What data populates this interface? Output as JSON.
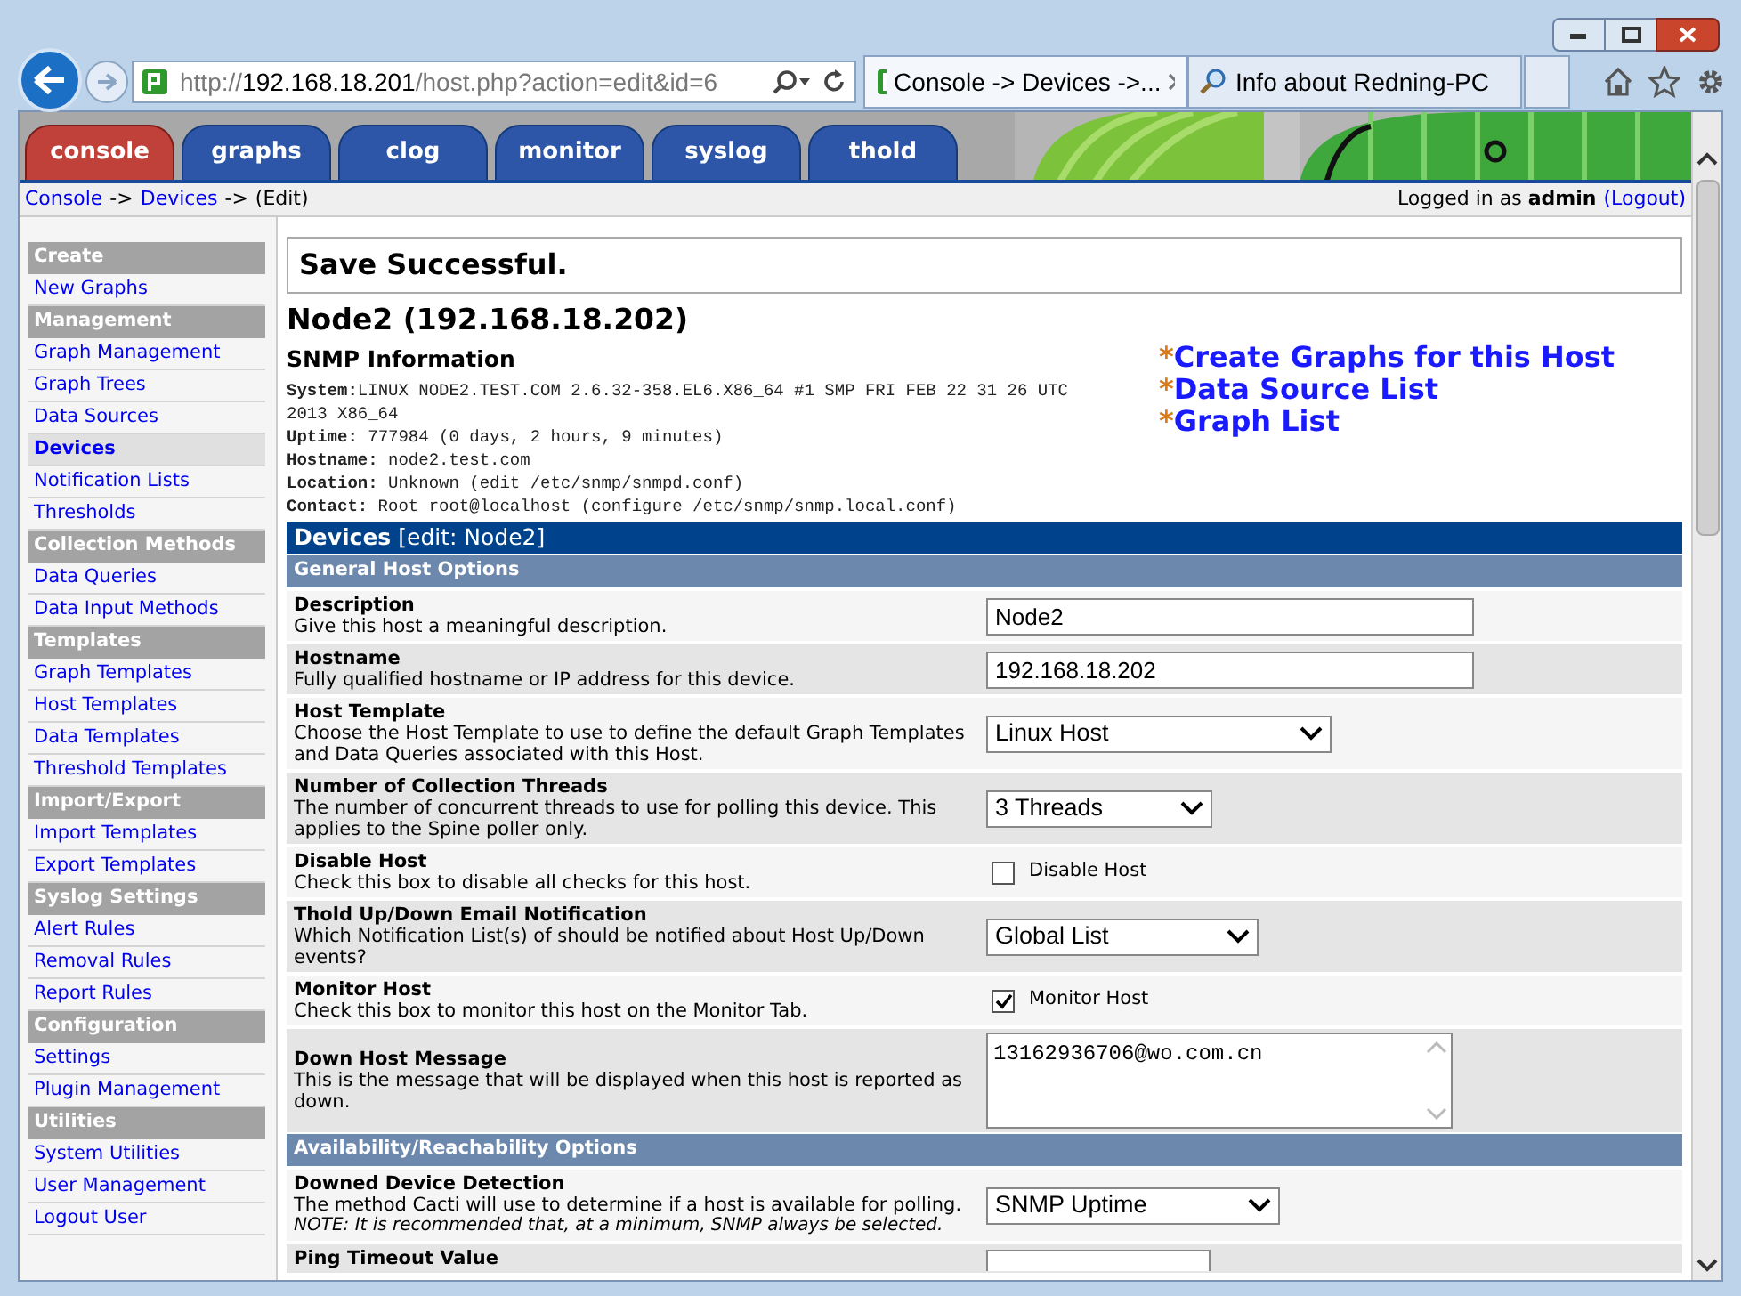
{
  "browser": {
    "address": {
      "scheme": "http://",
      "host": "192.168.18.201",
      "path": "/host.php?action=edit&id=6"
    },
    "tabs": [
      {
        "label": "Console -> Devices ->...",
        "selected": true
      },
      {
        "label": "Info about Redning-PC",
        "selected": false
      }
    ]
  },
  "nav_tabs": [
    {
      "label": "console",
      "selected": true
    },
    {
      "label": "graphs",
      "selected": false
    },
    {
      "label": "clog",
      "selected": false
    },
    {
      "label": "monitor",
      "selected": false
    },
    {
      "label": "syslog",
      "selected": false
    },
    {
      "label": "thold",
      "selected": false
    }
  ],
  "breadcrumb": {
    "links": [
      "Console",
      "Devices"
    ],
    "separator": "->",
    "current": "(Edit)"
  },
  "login": {
    "text": "Logged in as **admin**",
    "logout": "(Logout)"
  },
  "sidebar": {
    "items": [
      {
        "kind": "header",
        "label": "Create"
      },
      {
        "kind": "link",
        "label": "New Graphs",
        "selected": false
      },
      {
        "kind": "header",
        "label": "Management"
      },
      {
        "kind": "link",
        "label": "Graph Management",
        "selected": false
      },
      {
        "kind": "link",
        "label": "Graph Trees",
        "selected": false
      },
      {
        "kind": "link",
        "label": "Data Sources",
        "selected": false
      },
      {
        "kind": "link",
        "label": "Devices",
        "selected": true
      },
      {
        "kind": "link",
        "label": "Notification Lists",
        "selected": false
      },
      {
        "kind": "link",
        "label": "Thresholds",
        "selected": false
      },
      {
        "kind": "header",
        "label": "Collection Methods"
      },
      {
        "kind": "link",
        "label": "Data Queries",
        "selected": false
      },
      {
        "kind": "link",
        "label": "Data Input Methods",
        "selected": false
      },
      {
        "kind": "header",
        "label": "Templates"
      },
      {
        "kind": "link",
        "label": "Graph Templates",
        "selected": false
      },
      {
        "kind": "link",
        "label": "Host Templates",
        "selected": false
      },
      {
        "kind": "link",
        "label": "Data Templates",
        "selected": false
      },
      {
        "kind": "link",
        "label": "Threshold Templates",
        "selected": false
      },
      {
        "kind": "header",
        "label": "Import/Export"
      },
      {
        "kind": "link",
        "label": "Import Templates",
        "selected": false
      },
      {
        "kind": "link",
        "label": "Export Templates",
        "selected": false
      },
      {
        "kind": "header",
        "label": "Syslog Settings"
      },
      {
        "kind": "link",
        "label": "Alert Rules",
        "selected": false
      },
      {
        "kind": "link",
        "label": "Removal Rules",
        "selected": false
      },
      {
        "kind": "link",
        "label": "Report Rules",
        "selected": false
      },
      {
        "kind": "header",
        "label": "Configuration"
      },
      {
        "kind": "link",
        "label": "Settings",
        "selected": false
      },
      {
        "kind": "link",
        "label": "Plugin Management",
        "selected": false
      },
      {
        "kind": "header",
        "label": "Utilities"
      },
      {
        "kind": "link",
        "label": "System Utilities",
        "selected": false
      },
      {
        "kind": "link",
        "label": "User Management",
        "selected": false
      },
      {
        "kind": "link",
        "label": "Logout User",
        "selected": false
      }
    ]
  },
  "message": "Save Successful.",
  "host_title": "Node2 (192.168.18.202)",
  "snmp": {
    "title": "SNMP Information",
    "lines": [
      "**System:**LINUX NODE2.TEST.COM 2.6.32-358.EL6.X86_64 #1 SMP FRI FEB 22 31 26 UTC 2013 X86_64",
      "**Uptime:** 777984 (0 days, 2 hours, 9 minutes)",
      "**Hostname:** node2.test.com",
      "**Location:** Unknown (edit /etc/snmp/snmpd.conf)",
      "**Contact:** Root root@localhost (configure /etc/snmp/snmp.local.conf)"
    ]
  },
  "quick_links": [
    {
      "bullet": "*",
      "label": "Create Graphs for this Host"
    },
    {
      "bullet": "*",
      "label": "Data Source List"
    },
    {
      "bullet": "*",
      "label": "Graph List"
    }
  ],
  "form": {
    "title": "Devices",
    "subtitle": "[edit: Node2]",
    "rows": [
      {
        "kind": "section",
        "title": "General Host Options"
      },
      {
        "kind": "text",
        "title": "Description",
        "description": "Give this host a meaningful description.",
        "value": "Node2"
      },
      {
        "kind": "text",
        "title": "Hostname",
        "description": "Fully qualified hostname or IP address for this device.",
        "value": "192.168.18.202"
      },
      {
        "kind": "select",
        "title": "Host Template",
        "description": "Choose the Host Template to use to define the default Graph Templates and Data Queries associated with this Host.",
        "value": "Linux Host"
      },
      {
        "kind": "select",
        "title": "Number of Collection Threads",
        "description": "The number of concurrent threads to use for polling this device. This applies to the Spine poller only.",
        "value": "3 Threads"
      },
      {
        "kind": "checkbox",
        "title": "Disable Host",
        "description": "Check this box to disable all checks for this host.",
        "label": "Disable Host",
        "checked": false
      },
      {
        "kind": "select",
        "title": "Thold Up/Down Email Notification",
        "description": "Which Notification List(s) of should be notified about Host Up/Down events?",
        "value": "Global List"
      },
      {
        "kind": "checkbox",
        "title": "Monitor Host",
        "description": "Check this box to monitor this host on the Monitor Tab.",
        "label": "Monitor Host",
        "checked": true
      },
      {
        "kind": "textarea",
        "title": "Down Host Message",
        "description": "This is the message that will be displayed when this host is reported as down.",
        "value": "13162936706@wo.com.cn"
      },
      {
        "kind": "section",
        "title": "Availability/Reachability Options"
      },
      {
        "kind": "select",
        "title": "Downed Device Detection",
        "description": "The method Cacti will use to determine if a host is available for polling.",
        "note": "NOTE: It is recommended that, at a minimum, SNMP always be selected.",
        "value": "SNMP Uptime"
      },
      {
        "kind": "partial",
        "title": "Ping Timeout Value"
      }
    ]
  }
}
